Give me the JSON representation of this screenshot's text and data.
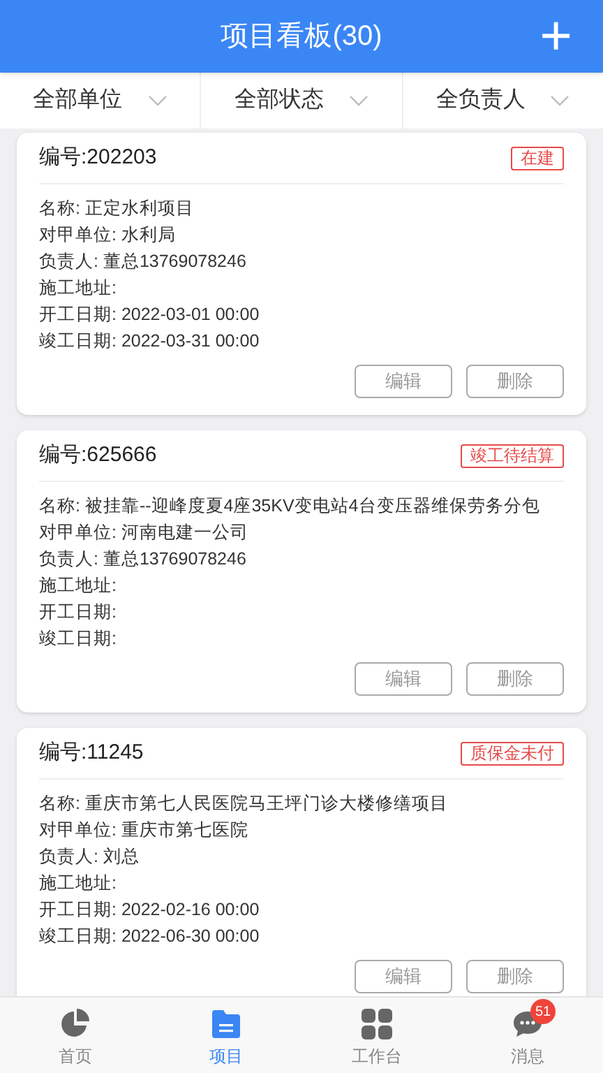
{
  "header": {
    "title": "项目看板(30)",
    "add_button": "+"
  },
  "filters": [
    {
      "label": "全部单位"
    },
    {
      "label": "全部状态"
    },
    {
      "label": "全负责人"
    }
  ],
  "projects": [
    {
      "number": "编号:202203",
      "status": "在建",
      "fields": [
        "名称: 正定水利项目",
        "对甲单位: 水利局",
        "负责人: 董总13769078246",
        "施工地址:",
        "开工日期: 2022-03-01 00:00",
        "竣工日期: 2022-03-31 00:00"
      ],
      "buttons": [
        "编辑",
        "删除"
      ]
    },
    {
      "number": "编号:625666",
      "status": "竣工待结算",
      "fields": [
        "名称: 被挂靠--迎峰度夏4座35KV变电站4台变压器维保劳务分包",
        "对甲单位: 河南电建一公司",
        "负责人: 董总13769078246",
        "施工地址:",
        "开工日期:",
        "竣工日期:"
      ],
      "buttons": [
        "编辑",
        "删除"
      ]
    },
    {
      "number": "编号:11245",
      "status": "质保金未付",
      "fields": [
        "名称: 重庆市第七人民医院马王坪门诊大楼修缮项目",
        "对甲单位: 重庆市第七医院",
        "负责人: 刘总",
        "施工地址:",
        "开工日期: 2022-02-16 00:00",
        "竣工日期: 2022-06-30 00:00"
      ],
      "buttons": [
        "编辑",
        "删除"
      ]
    }
  ],
  "tab_bar": [
    {
      "kind": "home",
      "label": "首页",
      "selected": false
    },
    {
      "kind": "project",
      "label": "项目",
      "selected": true
    },
    {
      "kind": "workbench",
      "label": "工作台",
      "selected": false
    },
    {
      "kind": "message",
      "label": "消息",
      "selected": false,
      "badge": "51"
    }
  ]
}
